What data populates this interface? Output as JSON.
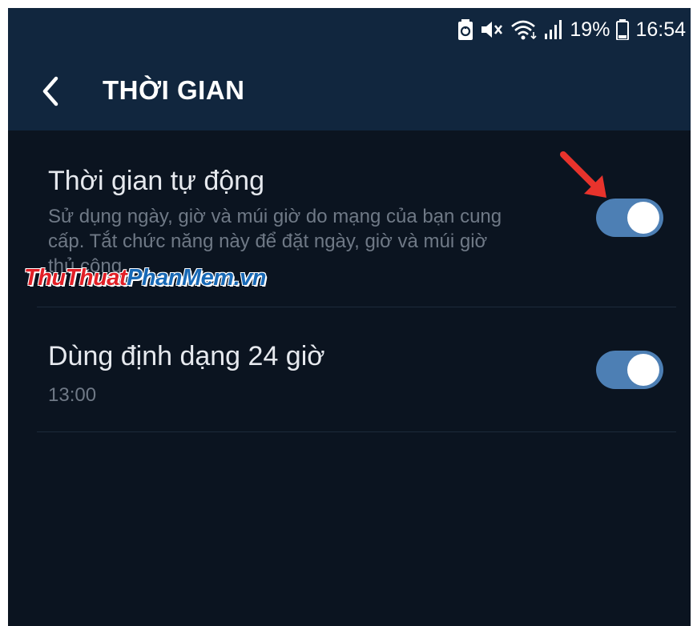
{
  "status_bar": {
    "battery_percent": "19%",
    "time": "16:54"
  },
  "header": {
    "title": "THỜI GIAN"
  },
  "settings": [
    {
      "title": "Thời gian tự động",
      "description": "Sử dụng ngày, giờ và múi giờ do mạng của bạn cung cấp. Tắt chức năng này để đặt ngày, giờ và múi giờ thủ công.",
      "enabled": true
    },
    {
      "title": "Dùng định dạng 24 giờ",
      "description": "13:00",
      "enabled": true
    }
  ],
  "watermark": {
    "part1": "ThuThuat",
    "part2": "PhanMem",
    "part3": ".vn"
  },
  "colors": {
    "toggle_on": "#4d7fb4",
    "header_bg": "#11263e",
    "body_bg": "#0b1420",
    "annotation_arrow": "#e8332c"
  }
}
